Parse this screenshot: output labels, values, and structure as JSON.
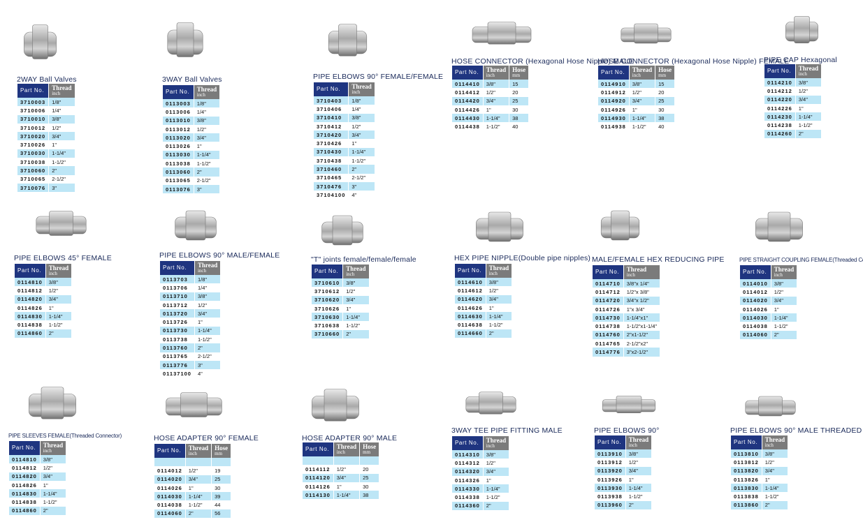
{
  "header": {
    "part_no": "Part No.",
    "thread": "Thread",
    "thread_unit": "inch",
    "hose": "Hose",
    "hose_unit": "mm"
  },
  "colors": {
    "part_header": "#1f3580",
    "col_header": "#7b7b7b",
    "row_alt": "#bde6f6",
    "title": "#1a2a5a"
  },
  "products": [
    {
      "title": "2WAY Ball Valves",
      "icon": "ball-valve-2way",
      "hose": false,
      "rows": [
        [
          "3710003",
          "1/8\""
        ],
        [
          "3710006",
          "1/4\""
        ],
        [
          "3710010",
          "3/8\""
        ],
        [
          "3710012",
          "1/2\""
        ],
        [
          "3710020",
          "3/4\""
        ],
        [
          "3710026",
          "1\""
        ],
        [
          "3710030",
          "1-1/4\""
        ],
        [
          "3710038",
          "1-1/2\""
        ],
        [
          "3710060",
          "2\""
        ],
        [
          "3710065",
          "2-1/2\""
        ],
        [
          "3710076",
          "3\""
        ]
      ]
    },
    {
      "title": "3WAY Ball Valves",
      "icon": "ball-valve-3way",
      "hose": false,
      "rows": [
        [
          "0113003",
          "1/8\""
        ],
        [
          "0113006",
          "1/4\""
        ],
        [
          "0113010",
          "3/8\""
        ],
        [
          "0113012",
          "1/2\""
        ],
        [
          "0113020",
          "3/4\""
        ],
        [
          "0113026",
          "1\""
        ],
        [
          "0113030",
          "1-1/4\""
        ],
        [
          "0113038",
          "1-1/2\""
        ],
        [
          "0113060",
          "2\""
        ],
        [
          "0113065",
          "2-1/2\""
        ],
        [
          "0113076",
          "3\""
        ]
      ]
    },
    {
      "title": "PIPE ELBOWS 90° FEMALE/FEMALE",
      "icon": "elbow-90",
      "hose": false,
      "rows": [
        [
          "3710403",
          "1/8\""
        ],
        [
          "3710406",
          "1/4\""
        ],
        [
          "3710410",
          "3/8\""
        ],
        [
          "3710412",
          "1/2\""
        ],
        [
          "3710420",
          "3/4\""
        ],
        [
          "3710426",
          "1\""
        ],
        [
          "3710430",
          "1-1/4\""
        ],
        [
          "3710438",
          "1-1/2\""
        ],
        [
          "3710460",
          "2\""
        ],
        [
          "3710465",
          "2-1/2\""
        ],
        [
          "3710476",
          "3\""
        ],
        [
          "37104100",
          "4\""
        ]
      ]
    },
    {
      "title": "HOSE CONNECTOR (Hexagonal Hose Nipple) MALE",
      "icon": "hose-connector-male",
      "hose": true,
      "rows": [
        [
          "0114410",
          "3/8\"",
          "15"
        ],
        [
          "0114412",
          "1/2\"",
          "20"
        ],
        [
          "0114420",
          "3/4\"",
          "25"
        ],
        [
          "0114426",
          "1\"",
          "30"
        ],
        [
          "0114430",
          "1-1/4\"",
          "38"
        ],
        [
          "0114438",
          "1-1/2\"",
          "40"
        ]
      ]
    },
    {
      "title": "HOSE CONNECTOR (Hexagonal Hose Nipple) FEMALE",
      "icon": "hose-connector-female",
      "hose": true,
      "rows": [
        [
          "0114910",
          "3/8\"",
          "15"
        ],
        [
          "0114912",
          "1/2\"",
          "20"
        ],
        [
          "0114920",
          "3/4\"",
          "25"
        ],
        [
          "0114926",
          "1\"",
          "30"
        ],
        [
          "0114930",
          "1-1/4\"",
          "38"
        ],
        [
          "0114938",
          "1-1/2\"",
          "40"
        ]
      ]
    },
    {
      "title": "PIPE CAP Hexagonal",
      "icon": "pipe-cap",
      "hose": false,
      "rows": [
        [
          "0114210",
          "3/8\""
        ],
        [
          "0114212",
          "1/2\""
        ],
        [
          "0114220",
          "3/4\""
        ],
        [
          "0114226",
          "1\""
        ],
        [
          "0114230",
          "1-1/4\""
        ],
        [
          "0114238",
          "1-1/2\""
        ],
        [
          "0114260",
          "2\""
        ]
      ]
    },
    {
      "title": "PIPE ELBOWS 45° FEMALE",
      "icon": "elbow-45",
      "hose": false,
      "rows": [
        [
          "0114810",
          "3/8\""
        ],
        [
          "0114812",
          "1/2\""
        ],
        [
          "0114820",
          "3/4\""
        ],
        [
          "0114826",
          "1\""
        ],
        [
          "0114830",
          "1-1/4\""
        ],
        [
          "0114838",
          "1-1/2\""
        ],
        [
          "0114860",
          "2\""
        ]
      ]
    },
    {
      "title": "PIPE ELBOWS 90° MALE/FEMALE",
      "icon": "elbow-90-male-female",
      "hose": false,
      "rows": [
        [
          "0113703",
          "1/8\""
        ],
        [
          "0113706",
          "1/4\""
        ],
        [
          "0113710",
          "3/8\""
        ],
        [
          "0113712",
          "1/2\""
        ],
        [
          "0113720",
          "3/4\""
        ],
        [
          "0113726",
          "1\""
        ],
        [
          "0113730",
          "1-1/4\""
        ],
        [
          "0113738",
          "1-1/2\""
        ],
        [
          "0113760",
          "2\""
        ],
        [
          "0113765",
          "2-1/2\""
        ],
        [
          "0113776",
          "3\""
        ],
        [
          "01137100",
          "4\""
        ]
      ]
    },
    {
      "title": "\"T\" joints female/female/female",
      "icon": "tee-joint",
      "hose": false,
      "rows": [
        [
          "3710610",
          "3/8\""
        ],
        [
          "3710612",
          "1/2\""
        ],
        [
          "3710620",
          "3/4\""
        ],
        [
          "3710626",
          "1\""
        ],
        [
          "3710630",
          "1-1/4\""
        ],
        [
          "3710638",
          "1-1/2\""
        ],
        [
          "3710660",
          "2\""
        ]
      ]
    },
    {
      "title": "HEX PIPE NIPPLE(Double pipe nipples)",
      "icon": "hex-nipple",
      "hose": false,
      "rows": [
        [
          "0114610",
          "3/8\""
        ],
        [
          "0114612",
          "1/2\""
        ],
        [
          "0114620",
          "3/4\""
        ],
        [
          "0114626",
          "1\""
        ],
        [
          "0114630",
          "1-1/4\""
        ],
        [
          "0114638",
          "1-1/2\""
        ],
        [
          "0114660",
          "2\""
        ]
      ]
    },
    {
      "title": "MALE/FEMALE HEX REDUCING PIPE",
      "icon": "hex-reducer",
      "hose": false,
      "rows": [
        [
          "0114710",
          "3/8\"x 1/4\""
        ],
        [
          "0114712",
          "1/2\"x 3/8\""
        ],
        [
          "0114720",
          "3/4\"x 1/2\""
        ],
        [
          "0114726",
          "1\"x 3/4\""
        ],
        [
          "0114730",
          "1-1/4\"x1\""
        ],
        [
          "0114738",
          "1-1/2\"x1-1/4\""
        ],
        [
          "0114760",
          "2\"x1-1/2\""
        ],
        [
          "0114765",
          "2-1/2\"x2\""
        ],
        [
          "0114776",
          "3\"x2-1/2\""
        ]
      ]
    },
    {
      "title": "PIPE STRAIGHT COUPLING FEMALE(Threaded Connector)",
      "icon": "straight-coupling",
      "hose": false,
      "small": true,
      "rows": [
        [
          "0114010",
          "3/8\""
        ],
        [
          "0114012",
          "1/2\""
        ],
        [
          "0114020",
          "3/4\""
        ],
        [
          "0114026",
          "1\""
        ],
        [
          "0114030",
          "1-1/4\""
        ],
        [
          "0114038",
          "1-1/2\""
        ],
        [
          "0114060",
          "2\""
        ]
      ]
    },
    {
      "title": "PIPE SLEEVES FEMALE(Threaded Connector)",
      "icon": "pipe-sleeve",
      "hose": false,
      "small": true,
      "rows": [
        [
          "0114810",
          "3/8\""
        ],
        [
          "0114812",
          "1/2\""
        ],
        [
          "0114820",
          "3/4\""
        ],
        [
          "0114826",
          "1\""
        ],
        [
          "0114830",
          "1-1/4\""
        ],
        [
          "0114838",
          "1-1/2\""
        ],
        [
          "0114860",
          "2\""
        ]
      ]
    },
    {
      "title": "HOSE ADAPTER 90° FEMALE",
      "icon": "hose-adapter-female",
      "hose": true,
      "blank_first": true,
      "rows": [
        [
          "0114012",
          "1/2\"",
          "19"
        ],
        [
          "0114020",
          "3/4\"",
          "25"
        ],
        [
          "0114026",
          "1\"",
          "30"
        ],
        [
          "0114030",
          "1-1/4\"",
          "39"
        ],
        [
          "0114038",
          "1-1/2\"",
          "44"
        ],
        [
          "0114060",
          "2\"",
          "56"
        ]
      ]
    },
    {
      "title": "HOSE ADAPTER 90° MALE",
      "icon": "hose-adapter-male",
      "hose": true,
      "blank_first": true,
      "rows": [
        [
          "0114112",
          "1/2\"",
          "20"
        ],
        [
          "0114120",
          "3/4\"",
          "25"
        ],
        [
          "0114126",
          "1\"",
          "30"
        ],
        [
          "0114130",
          "1-1/4\"",
          "38"
        ]
      ]
    },
    {
      "title": "3WAY TEE PIPE FITTING MALE",
      "icon": "tee-press-fitting",
      "hose": false,
      "rows": [
        [
          "0114310",
          "3/8\""
        ],
        [
          "0114312",
          "1/2\""
        ],
        [
          "0114320",
          "3/4\""
        ],
        [
          "0114326",
          "1\""
        ],
        [
          "0114330",
          "1-1/4\""
        ],
        [
          "0114338",
          "1-1/2\""
        ],
        [
          "0114360",
          "2\""
        ]
      ]
    },
    {
      "title": "PIPE ELBOWS 90°",
      "icon": "press-elbow-90",
      "hose": false,
      "rows": [
        [
          "0113910",
          "3/8\""
        ],
        [
          "0113912",
          "1/2\""
        ],
        [
          "0113920",
          "3/4\""
        ],
        [
          "0113926",
          "1\""
        ],
        [
          "0113930",
          "1-1/4\""
        ],
        [
          "0113938",
          "1-1/2\""
        ],
        [
          "0113960",
          "2\""
        ]
      ]
    },
    {
      "title": "PIPE ELBOWS 90° MALE THREADED",
      "icon": "press-elbow-90-male",
      "hose": false,
      "rows": [
        [
          "0113810",
          "3/8\""
        ],
        [
          "0113812",
          "1/2\""
        ],
        [
          "0113820",
          "3/4\""
        ],
        [
          "0113826",
          "1\""
        ],
        [
          "0113830",
          "1-1/4\""
        ],
        [
          "0113838",
          "1-1/2\""
        ],
        [
          "0113860",
          "2\""
        ]
      ]
    }
  ]
}
